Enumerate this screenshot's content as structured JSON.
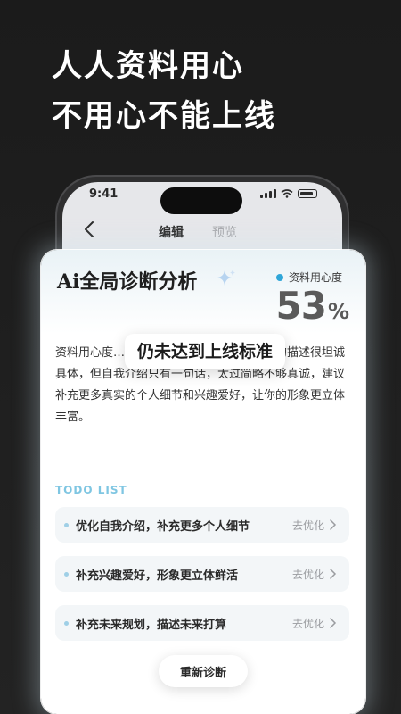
{
  "headline": {
    "line1": "人人资料用心",
    "line2": "不用心不能上线"
  },
  "status_bar": {
    "time": "9:41"
  },
  "nav": {
    "tabs": [
      {
        "label": "编辑",
        "active": true
      },
      {
        "label": "预览",
        "active": false
      }
    ]
  },
  "card": {
    "title": "Ai全局诊断分析",
    "score_label": "资料用心度",
    "score_value": "53",
    "score_unit": "%",
    "highlight": "仍未达到上线标准",
    "analysis": "资料用心度……，你对家庭情况和择偶诉求的描述很坦诚具体，但自我介绍只有一句话，太过简略不够真诚，建议补充更多真实的个人细节和兴趣爱好，让你的形象更立体丰富。",
    "todo_title": "TODO LIST",
    "todos": [
      {
        "text": "优化自我介绍，补充更多个人细节",
        "action": "去优化"
      },
      {
        "text": "补充兴趣爱好，形象更立体鲜活",
        "action": "去优化"
      },
      {
        "text": "补充未来规划，描述未来打算",
        "action": "去优化"
      }
    ],
    "rediagnose_label": "重新诊断"
  },
  "colors": {
    "background": "#1b1b1b",
    "accent": "#2fa6d8",
    "todo_title": "#7fc6e2"
  }
}
